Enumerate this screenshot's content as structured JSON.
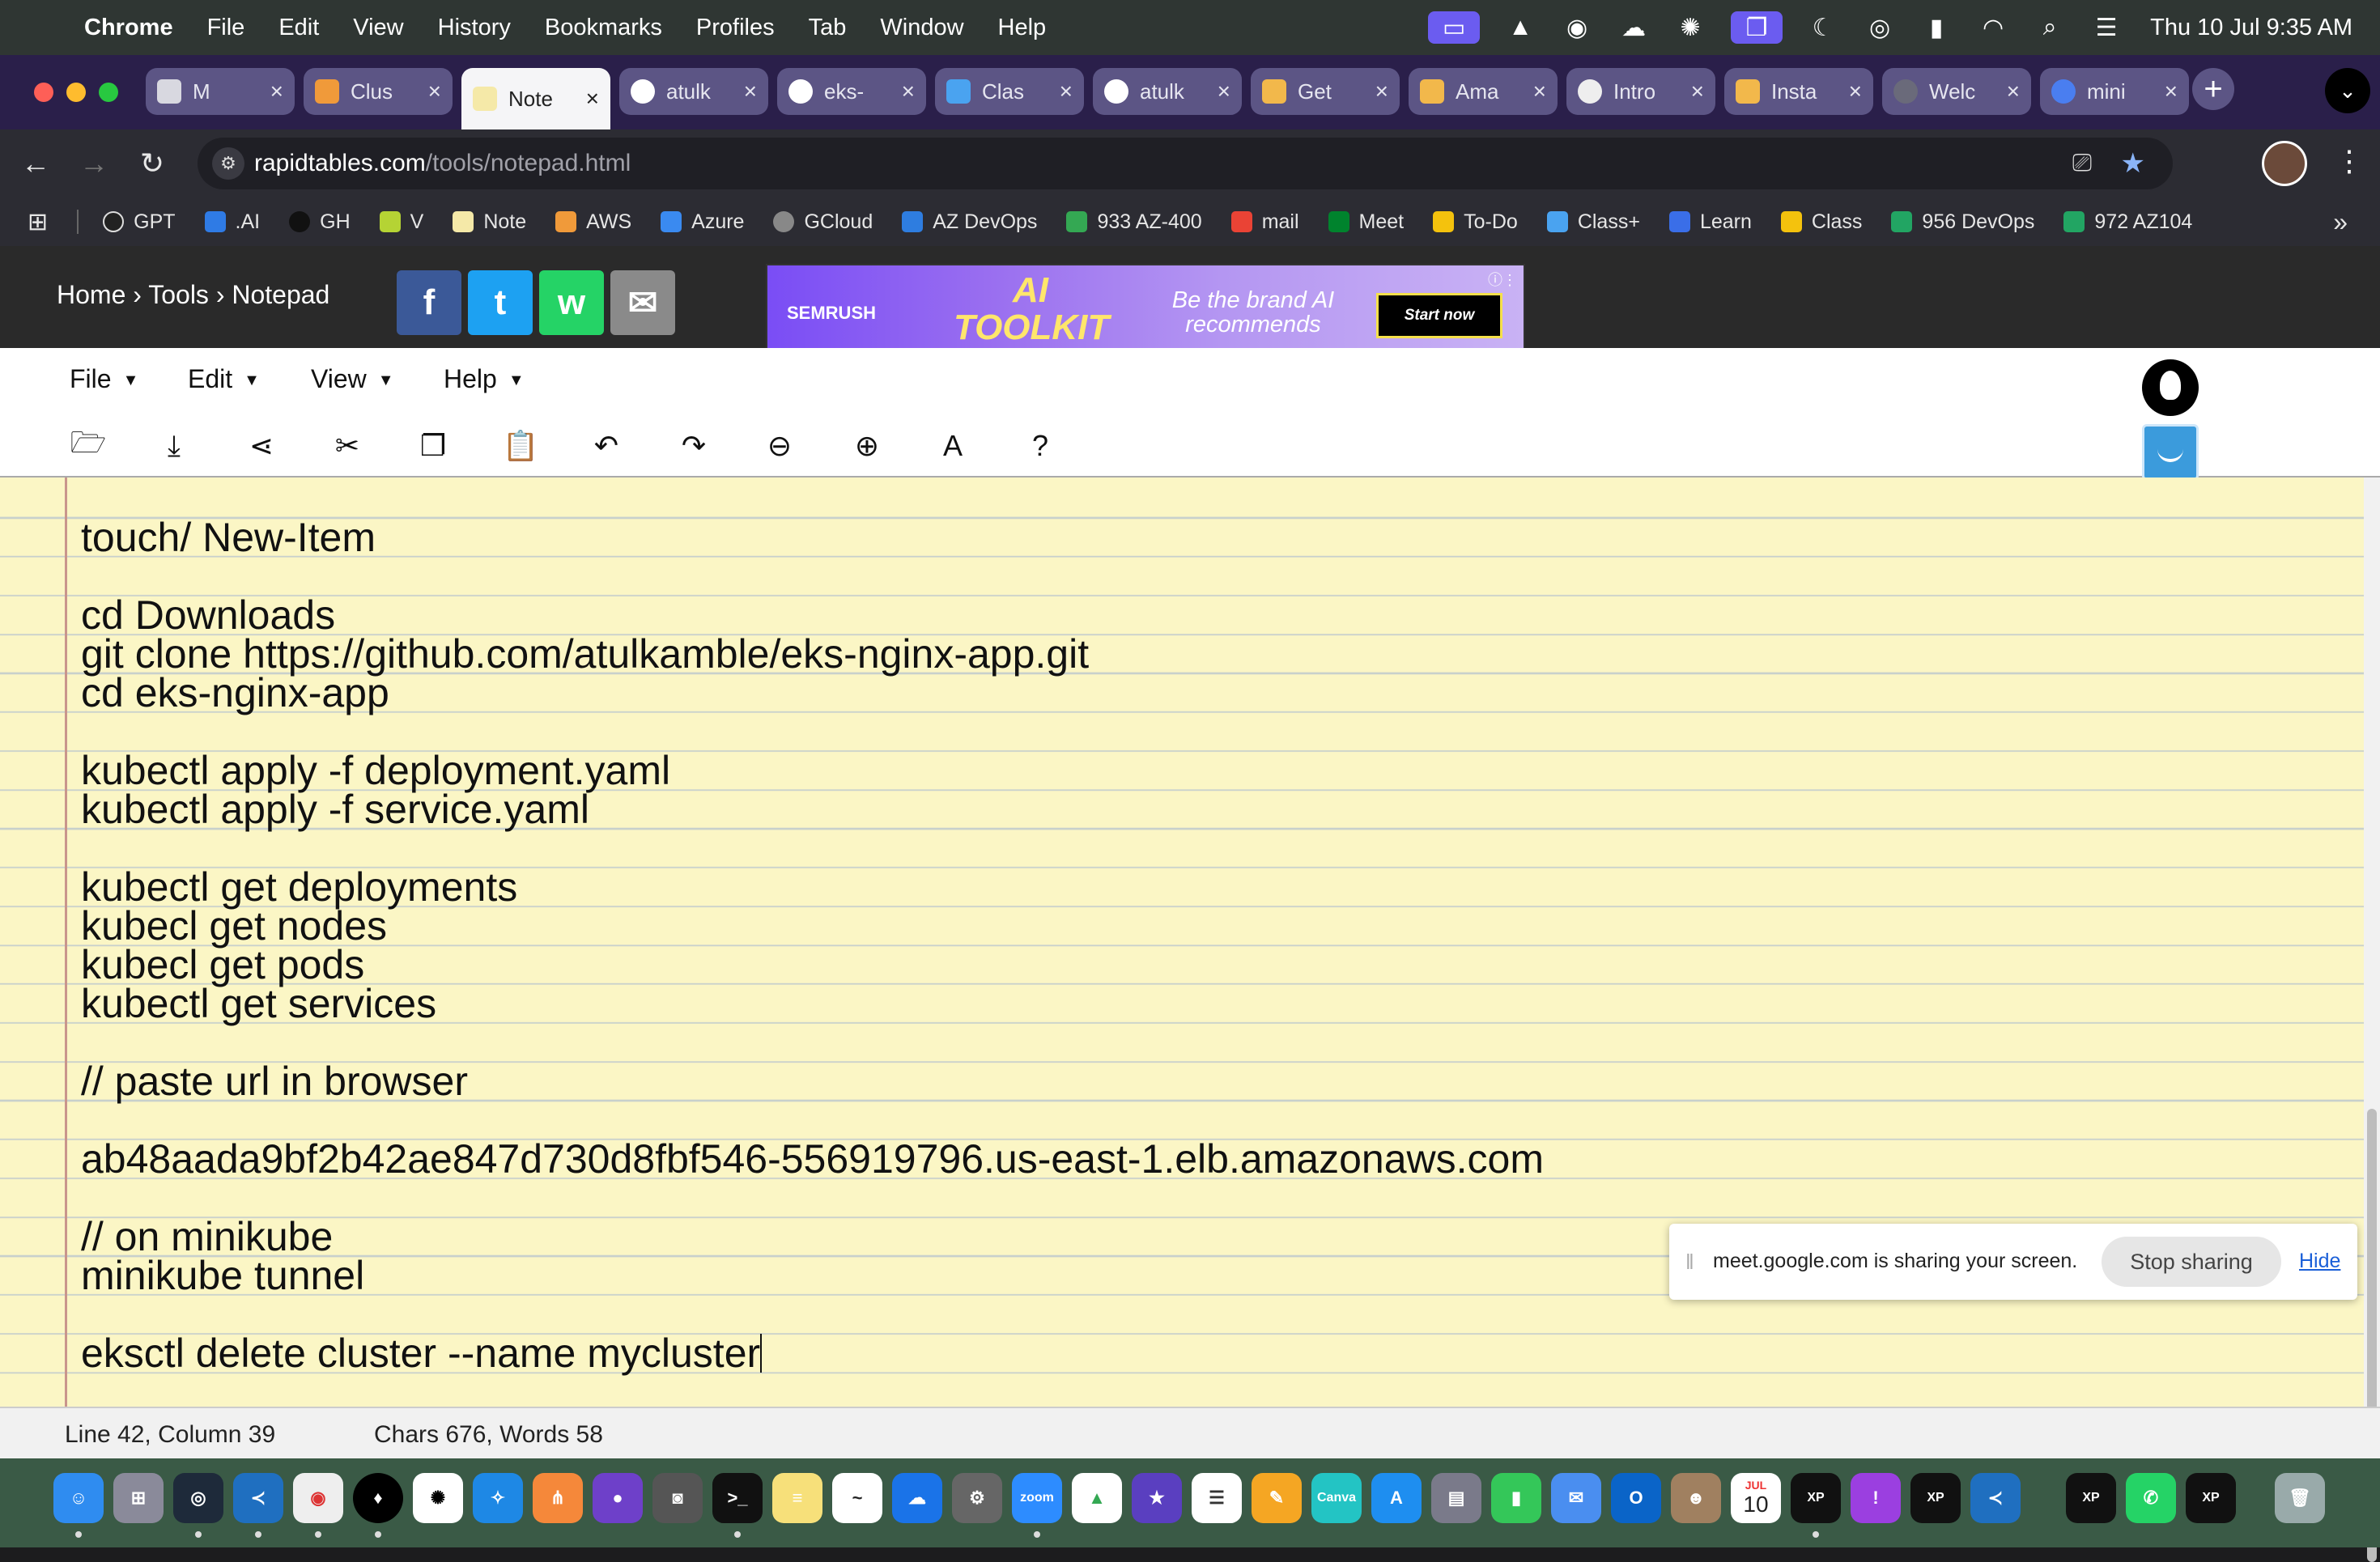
{
  "menubar": {
    "app_name": "Chrome",
    "items": [
      "File",
      "Edit",
      "View",
      "History",
      "Bookmarks",
      "Profiles",
      "Tab",
      "Window",
      "Help"
    ],
    "clock": "Thu 10 Jul  9:35 AM"
  },
  "tabs": [
    {
      "title": "M",
      "active": false
    },
    {
      "title": "Clus",
      "active": false
    },
    {
      "title": "Note",
      "active": true
    },
    {
      "title": "atulk",
      "active": false
    },
    {
      "title": "eks-",
      "active": false
    },
    {
      "title": "Clas",
      "active": false
    },
    {
      "title": "atulk",
      "active": false
    },
    {
      "title": "Get",
      "active": false
    },
    {
      "title": "Ama",
      "active": false
    },
    {
      "title": "Intro",
      "active": false
    },
    {
      "title": "Insta",
      "active": false
    },
    {
      "title": "Welc",
      "active": false
    },
    {
      "title": "mini",
      "active": false
    }
  ],
  "address": {
    "host": "rapidtables.com",
    "path": "/tools/notepad.html"
  },
  "bookmarks": [
    "GPT",
    ".AI",
    "GH",
    "V",
    "Note",
    "AWS",
    "Azure",
    "GCloud",
    "AZ DevOps",
    "933 AZ-400",
    "mail",
    "Meet",
    "To-Do",
    "Class+",
    "Learn",
    "Class",
    "956 DevOps",
    "972 AZ104"
  ],
  "site": {
    "breadcrumb": "Home › Tools › Notepad",
    "social": [
      "f",
      "t",
      "w",
      "✉"
    ],
    "ad": {
      "brand": "SEMRUSH",
      "headline": "AI TOOLKIT",
      "tagline": "Be the brand AI recommends",
      "cta": "Start now"
    }
  },
  "editor_menu": [
    "File",
    "Edit",
    "View",
    "Help"
  ],
  "editor": {
    "lines": [
      "touch/ New-Item",
      "",
      "cd Downloads",
      "git clone https://github.com/atulkamble/eks-nginx-app.git",
      "cd eks-nginx-app",
      "",
      "kubectl apply -f deployment.yaml",
      "kubectl apply -f service.yaml",
      "",
      "kubectl get deployments",
      "kubecl get nodes",
      "kubecl get pods",
      "kubectl get services",
      "",
      "// paste url in browser",
      "",
      "ab48aada9bf2b42ae847d730d8fbf546-556919796.us-east-1.elb.amazonaws.com",
      "",
      "// on minikube",
      "minikube tunnel",
      "",
      "eksctl delete cluster --name mycluster"
    ]
  },
  "status": {
    "position": "Line 42, Column 39",
    "counts": "Chars 676, Words 58"
  },
  "share_notice": {
    "message": "meet.google.com is sharing your screen.",
    "stop_label": "Stop sharing",
    "hide_label": "Hide"
  },
  "dock": {
    "calendar_month": "JUL",
    "calendar_day": "10"
  }
}
